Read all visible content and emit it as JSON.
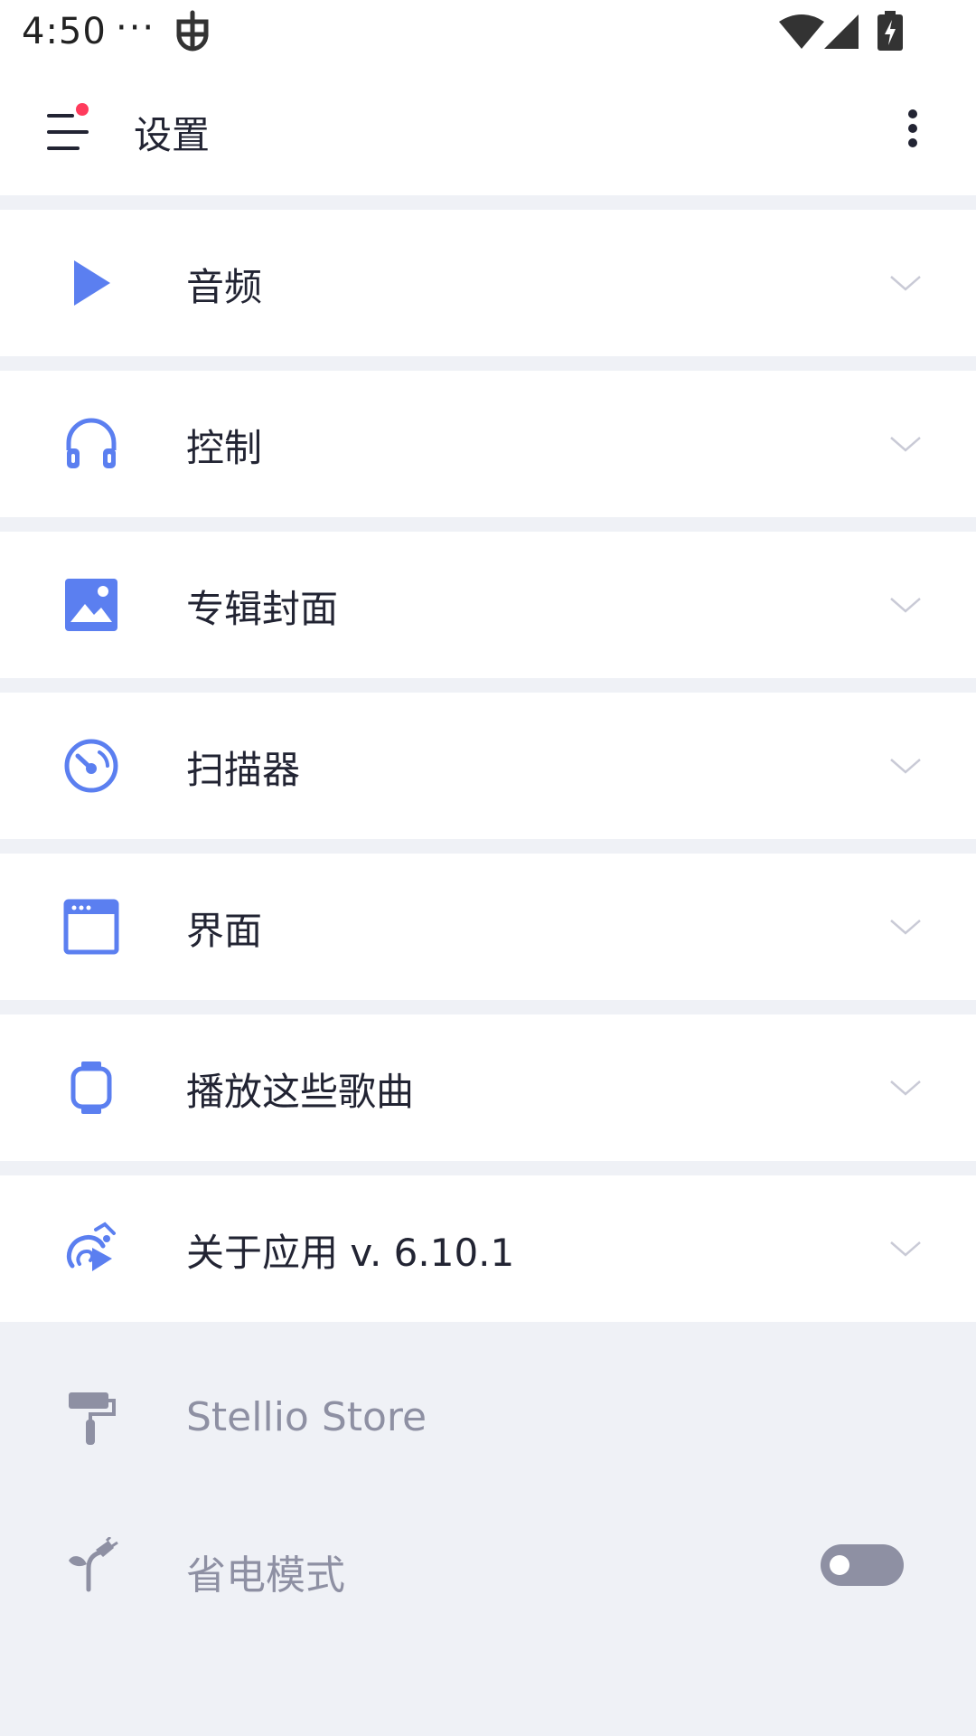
{
  "status_bar": {
    "time": "4:50",
    "dots": "···"
  },
  "app_bar": {
    "title": "设置",
    "notification_color": "#ff3b5c"
  },
  "settings": [
    {
      "label": "音频",
      "icon": "play-icon"
    },
    {
      "label": "控制",
      "icon": "headphones-icon"
    },
    {
      "label": "专辑封面",
      "icon": "image-icon"
    },
    {
      "label": "扫描器",
      "icon": "gauge-icon"
    },
    {
      "label": "界面",
      "icon": "window-icon"
    },
    {
      "label": "播放这些歌曲",
      "icon": "smartwatch-icon"
    },
    {
      "label": "关于应用 v. 6.10.1",
      "icon": "chameleon-icon"
    }
  ],
  "extras": [
    {
      "label": "Stellio Store",
      "icon": "paint-roller-icon"
    },
    {
      "label": "省电模式",
      "icon": "plug-leaf-icon",
      "toggle": false
    }
  ],
  "colors": {
    "accent": "#5b7ff0",
    "muted": "#8e90a3",
    "background": "#eff1f6"
  }
}
